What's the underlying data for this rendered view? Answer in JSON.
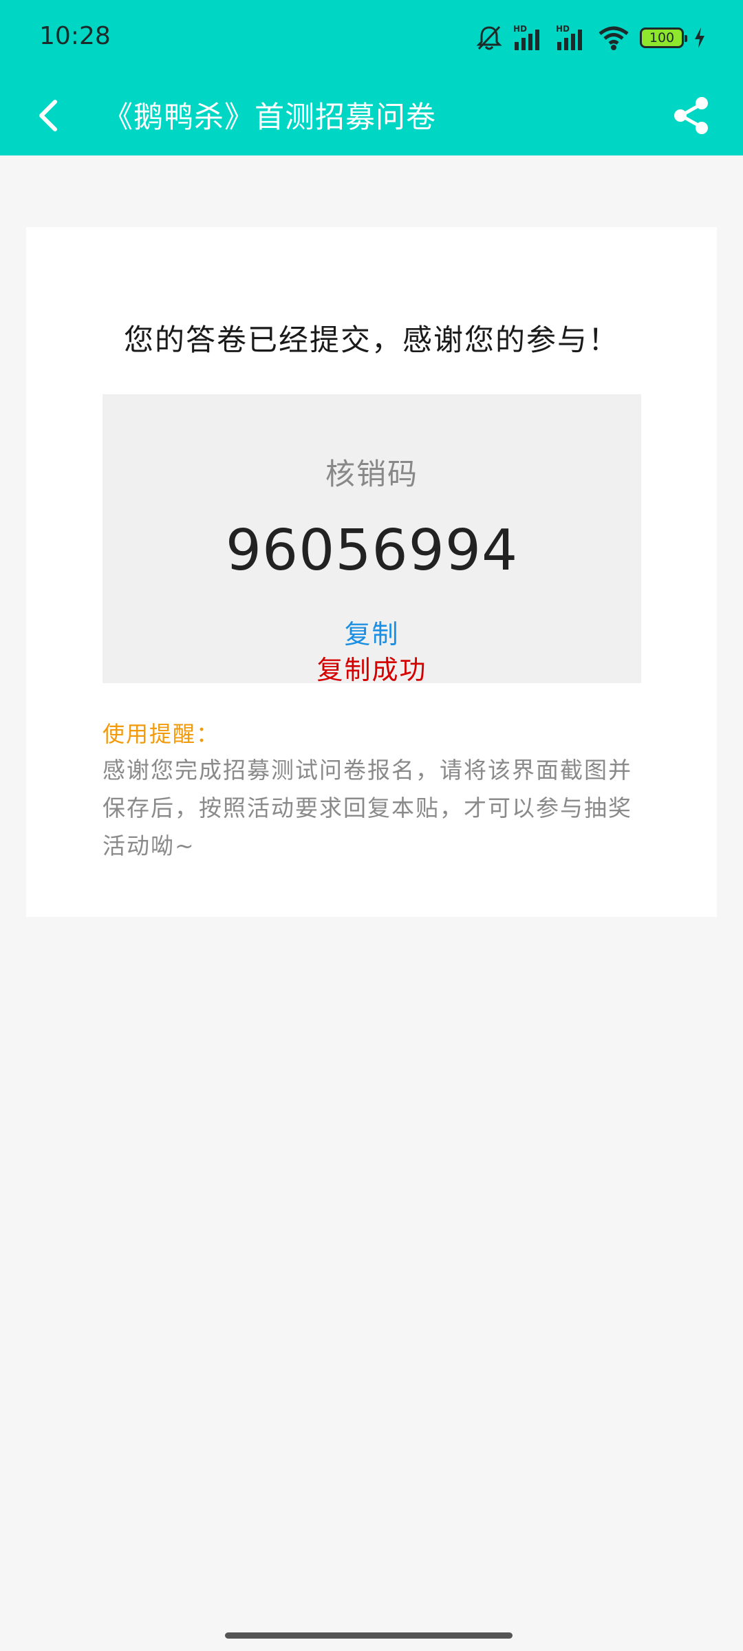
{
  "status_bar": {
    "time": "10:28",
    "network_1": "HD",
    "network_2": "HD",
    "battery": "100",
    "icons": [
      "bell-muted-icon",
      "signal-icon",
      "signal-icon",
      "wifi-icon",
      "battery-icon",
      "charging-icon"
    ]
  },
  "nav": {
    "title": "《鹅鸭杀》首测招募问卷",
    "back_icon": "chevron-left-icon",
    "share_icon": "share-icon"
  },
  "result": {
    "success_message": "您的答卷已经提交，感谢您的参与！",
    "code_label": "核销码",
    "code_value": "96056994",
    "copy_label": "复制",
    "copy_success_label": "复制成功"
  },
  "tip": {
    "title": "使用提醒：",
    "text": "感谢您完成招募测试问卷报名，请将该界面截图并保存后，按照活动要求回复本贴，才可以参与抽奖活动呦~"
  },
  "colors": {
    "header": "#00d6c4",
    "copy_link": "#1a8fe3",
    "copy_success": "#d40000",
    "tip_title": "#f29a0a"
  }
}
